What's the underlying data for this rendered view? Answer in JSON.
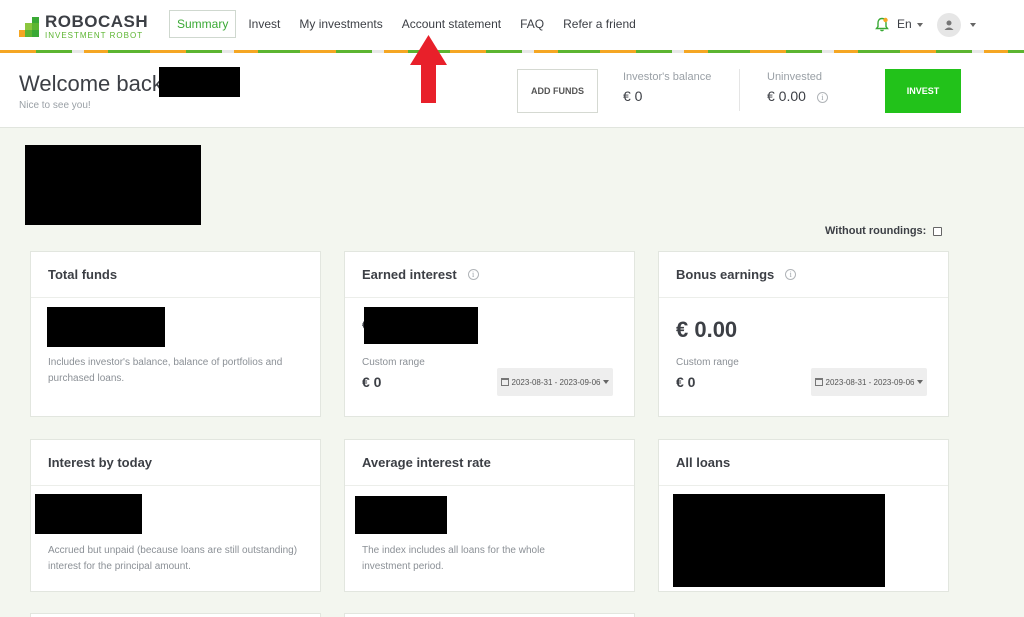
{
  "logo": {
    "name": "ROBOCASH",
    "tagline": "INVESTMENT ROBOT"
  },
  "nav": {
    "items": [
      "Summary",
      "Invest",
      "My investments",
      "Account statement",
      "FAQ",
      "Refer a friend"
    ],
    "active": "Summary"
  },
  "header_right": {
    "language": "En"
  },
  "welcome": {
    "title": "Welcome back",
    "subtitle": "Nice to see you!"
  },
  "actions": {
    "add_funds": "ADD FUNDS",
    "invest": "INVEST"
  },
  "stats": {
    "investors_balance_label": "Investor's balance",
    "investors_balance_value": "€ 0",
    "uninvested_label": "Uninvested",
    "uninvested_value": "€ 0.00"
  },
  "without_roundings": "Without roundings:",
  "cards": {
    "total_funds": {
      "title": "Total funds",
      "desc": "Includes investor's balance, balance of portfolios and purchased loans."
    },
    "earned_interest": {
      "title": "Earned interest",
      "value_prefix": "€",
      "range_label": "Custom range",
      "range_value": "€ 0",
      "date_range": "2023-08-31 - 2023-09-06"
    },
    "bonus_earnings": {
      "title": "Bonus earnings",
      "value": "€ 0.00",
      "range_label": "Custom range",
      "range_value": "€ 0",
      "date_range": "2023-08-31 - 2023-09-06"
    },
    "interest_by_today": {
      "title": "Interest by today",
      "desc": "Accrued but unpaid (because loans are still outstanding) interest for the principal amount."
    },
    "average_interest_rate": {
      "title": "Average interest rate",
      "desc": "The index includes all loans for the whole investment period."
    },
    "all_loans": {
      "title": "All loans"
    }
  },
  "colors": {
    "accent_green": "#22c21a",
    "brand_green": "#3aa935",
    "arrow_red": "#e8202a"
  }
}
